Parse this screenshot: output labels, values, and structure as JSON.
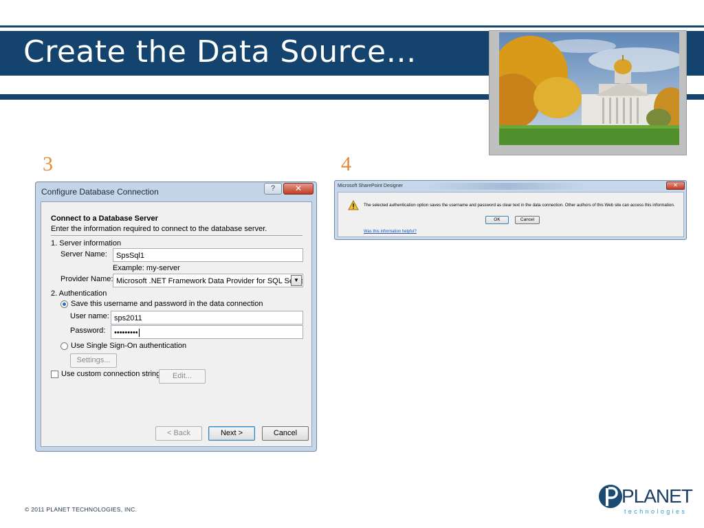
{
  "slide": {
    "title": "Create the Data Source…",
    "footer": "© 2011 PLANET TECHNOLOGIES, INC.",
    "logo": {
      "text": "PLANET",
      "tagline": "technologies"
    },
    "colors": {
      "brand_blue": "#14436e",
      "step_number": "#e58b3a"
    }
  },
  "steps": {
    "left": "3",
    "right": "4"
  },
  "config_dialog": {
    "title": "Configure Database Connection",
    "help_glyph": "?",
    "close_glyph": "✕",
    "heading": "Connect to a Database Server",
    "subheading": "Enter the information required to connect to the database server.",
    "server_section": "1. Server information",
    "server_name_label": "Server Name:",
    "server_name_value": "SpsSql1",
    "example_text": "Example: my-server",
    "provider_label": "Provider Name:",
    "provider_value": "Microsoft .NET Framework Data Provider for SQL Server",
    "auth_section": "2. Authentication",
    "save_credentials_label": "Save this username and password in the data connection",
    "save_credentials_selected": true,
    "username_label": "User name:",
    "username_value": "sps2011",
    "password_label": "Password:",
    "password_value": "•••••••••",
    "sso_label": "Use Single Sign-On authentication",
    "settings_button": "Settings...",
    "custom_string_label": "Use custom connection string",
    "edit_button": "Edit...",
    "back_button": "< Back",
    "next_button": "Next >",
    "cancel_button": "Cancel"
  },
  "warning_dialog": {
    "title": "Microsoft SharePoint Designer",
    "close_glyph": "✕",
    "message": "The selected authentication option saves the username and password as clear text in the data connection. Other authors of this Web site can access this information.",
    "ok_button": "OK",
    "cancel_button": "Cancel",
    "help_link": "Was this information helpful?",
    "icon": "warning-icon"
  }
}
